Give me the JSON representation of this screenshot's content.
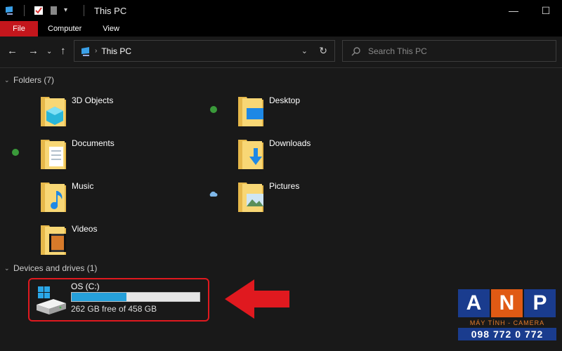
{
  "window": {
    "title": "This PC"
  },
  "ribbon": {
    "tabs": [
      "File",
      "Computer",
      "View"
    ]
  },
  "address": {
    "path": "This PC"
  },
  "search": {
    "placeholder": "Search This PC"
  },
  "folders": {
    "header": "Folders (7)",
    "items": [
      {
        "label": "3D Objects",
        "icon": "3d-objects-folder-icon",
        "status": ""
      },
      {
        "label": "Desktop",
        "icon": "desktop-folder-icon",
        "status": "synced"
      },
      {
        "label": "Documents",
        "icon": "documents-folder-icon",
        "status": "synced"
      },
      {
        "label": "Downloads",
        "icon": "downloads-folder-icon",
        "status": ""
      },
      {
        "label": "Music",
        "icon": "music-folder-icon",
        "status": ""
      },
      {
        "label": "Pictures",
        "icon": "pictures-folder-icon",
        "status": "cloud"
      },
      {
        "label": "Videos",
        "icon": "videos-folder-icon",
        "status": ""
      }
    ]
  },
  "drives": {
    "header": "Devices and drives (1)",
    "items": [
      {
        "name": "OS (C:)",
        "free_text": "262 GB free of 458 GB",
        "used_fraction": 0.428
      }
    ]
  },
  "watermark": {
    "letters": [
      "A",
      "N",
      "P"
    ],
    "subtitle": "MÁY TÍNH - CAMERA",
    "phone": "098 772 0 772"
  },
  "colors": {
    "accent": "#c4161c",
    "highlight": "#e0191f",
    "drive_bar": "#26a0da",
    "synced": "#3a9a3a"
  }
}
